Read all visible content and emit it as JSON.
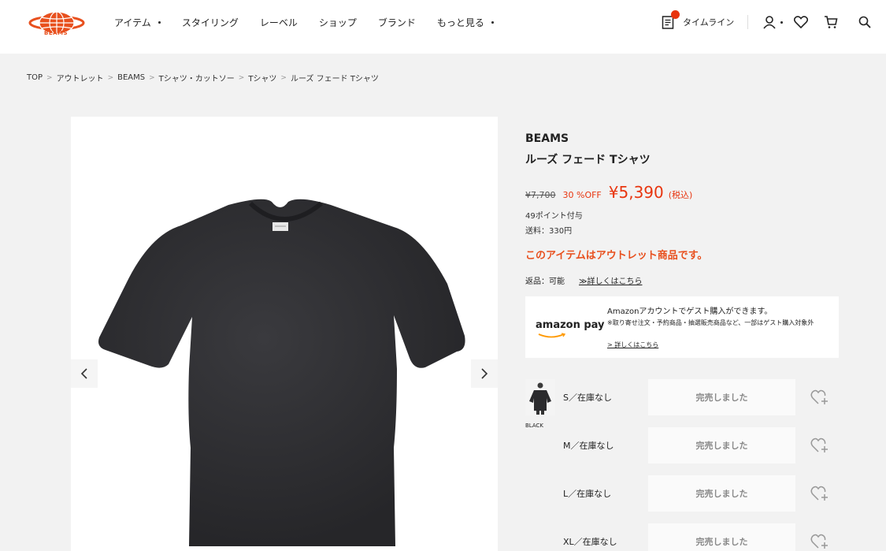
{
  "brand_logo": {
    "text": "BEAMS",
    "color": "#e8501e"
  },
  "nav": {
    "items": [
      {
        "label": "アイテム",
        "has_dropdown": true
      },
      {
        "label": "スタイリング",
        "has_dropdown": false
      },
      {
        "label": "レーベル",
        "has_dropdown": false
      },
      {
        "label": "ショップ",
        "has_dropdown": false
      },
      {
        "label": "ブランド",
        "has_dropdown": false
      },
      {
        "label": "もっと見る",
        "has_dropdown": true
      }
    ]
  },
  "header_right": {
    "timeline_label": "タイムライン",
    "icons": [
      "timeline-icon",
      "user-icon",
      "heart-icon",
      "cart-icon",
      "search-icon"
    ]
  },
  "breadcrumb": [
    "TOP",
    "アウトレット",
    "BEAMS",
    "Tシャツ・カットソー",
    "Tシャツ",
    "ルーズ フェード Tシャツ"
  ],
  "product": {
    "brand": "BEAMS",
    "name": "ルーズ フェード Tシャツ",
    "old_price": "¥7,700",
    "discount": "30 %OFF",
    "price": "¥5,390",
    "tax": "(税込)",
    "points": "49ポイント付与",
    "shipping": "送料：330円",
    "outlet_notice": "このアイテムはアウトレット商品です。",
    "return_label": "返品：可能",
    "return_link": "≫詳しくはこちら"
  },
  "amazon": {
    "logo_text": "amazon pay",
    "main_text": "Amazonアカウントでゲスト購入ができます。",
    "note_text": "※取り寄せ注文・予約商品・抽選販売商品など、一部はゲスト購入対象外",
    "link_text": "> 詳しくはこちら"
  },
  "variants": {
    "color_label": "BLACK",
    "sizes": [
      {
        "label": "S／在庫なし",
        "status": "完売しました"
      },
      {
        "label": "M／在庫なし",
        "status": "完売しました"
      },
      {
        "label": "L／在庫なし",
        "status": "完売しました"
      },
      {
        "label": "XL／在庫なし",
        "status": "完売しました"
      }
    ]
  },
  "colors": {
    "accent": "#e8350f",
    "outlet": "#e8501e",
    "shirt": "#2a2a2d"
  }
}
